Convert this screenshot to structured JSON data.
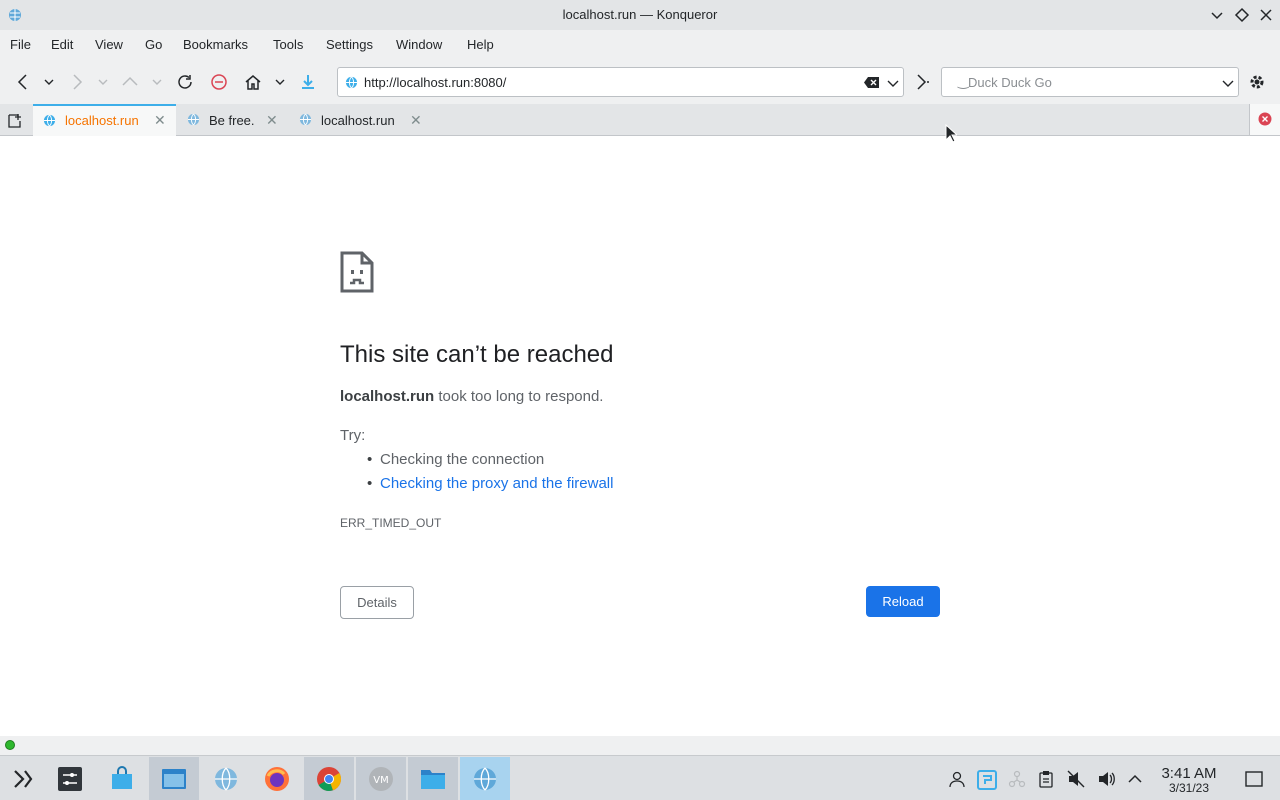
{
  "window": {
    "title": "localhost.run — Konqueror"
  },
  "menu": [
    "File",
    "Edit",
    "View",
    "Go",
    "Bookmarks",
    "Tools",
    "Settings",
    "Window",
    "Help"
  ],
  "address": {
    "url": "http://localhost.run:8080/"
  },
  "search": {
    "placeholder": "Duck Duck Go"
  },
  "tabs": [
    {
      "label": "localhost.run",
      "active": true
    },
    {
      "label": "Be free.",
      "active": false
    },
    {
      "label": "localhost.run",
      "active": false
    }
  ],
  "error_page": {
    "title": "This site can’t be reached",
    "host": "localhost.run",
    "message": "took too long to respond.",
    "try_label": "Try:",
    "suggestions": [
      "Checking the connection",
      "Checking the proxy and the firewall"
    ],
    "code": "ERR_TIMED_OUT",
    "details_label": "Details",
    "reload_label": "Reload"
  },
  "taskbar": {
    "apps": [
      "application-launcher",
      "system-settings",
      "discover-store",
      "file-manager",
      "konqueror",
      "firefox",
      "chrome",
      "vivaldi",
      "folder",
      "konqueror-active"
    ],
    "clock": "3:41 AM",
    "date": "3/31/23"
  },
  "colors": {
    "accent": "#3daee9",
    "active_tab_text": "#f67400",
    "link": "#1a73e8",
    "reload_button": "#1a73e8"
  }
}
